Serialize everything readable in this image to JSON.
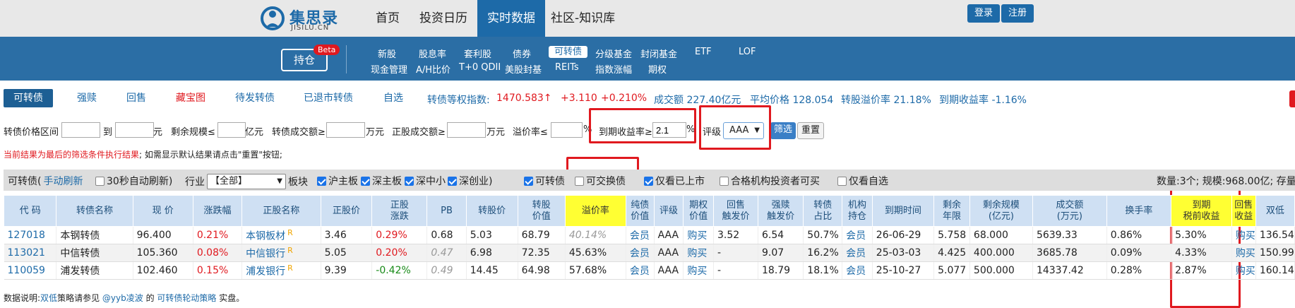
{
  "header": {
    "logo_cn": "集思录",
    "logo_en": "JISILU.CN",
    "nav": [
      "首页",
      "投资日历",
      "实时数据",
      "社区-知识库"
    ],
    "active_nav": "实时数据",
    "login": "登录",
    "register": "注册"
  },
  "subnav": {
    "hold_label": "持仓",
    "beta": "Beta",
    "row1": [
      "新股",
      "股息率",
      "套利股",
      "债券",
      "可转债",
      "分级基金",
      "封闭基金",
      "ETF",
      "LOF"
    ],
    "row2": [
      "现金管理",
      "A/H比价",
      "T+0 QDII",
      "美股封基",
      "REITs",
      "指数涨幅",
      "期权"
    ],
    "active": "可转债"
  },
  "tabs": [
    "可转债",
    "强赎",
    "回售",
    "藏宝图",
    "待发转债",
    "已退市转债",
    "自选"
  ],
  "stats": {
    "index_label": "转债等权指数:",
    "index_value": "1470.583↑",
    "change": "+3.110",
    "change_pct": "+0.210%",
    "volume": "成交额 227.40亿元",
    "avg_price": "平均价格 128.054",
    "premium": "转股溢价率 21.18%",
    "ytm": "到期收益率 -1.16%"
  },
  "filters": {
    "price_range": "转债价格区间",
    "to": "到",
    "yuan": "元",
    "remaining_scale": "剩余规模≤",
    "yiyuan": "亿元",
    "bond_volume": "转债成交额≥",
    "wanyuan1": "万元",
    "stock_volume": "正股成交额≥",
    "wanyuan2": "万元",
    "premium_rate": "溢价率≤",
    "pct": "%",
    "ytm_label": "到期收益率≥",
    "ytm_value": "2.1",
    "pct2": "%",
    "rating_label": "评级",
    "rating_value": "AAA",
    "filter_btn": "筛选",
    "reset_btn": "重置"
  },
  "note_red": "当前结果为最后的筛选条件执行结果",
  "note_rest": "; 如需显示默认结果请点击\"重置\"按钮;",
  "options": {
    "cb_label": "可转债(",
    "manual_refresh": "手动刷新",
    "auto_refresh": "30秒自动刷新)",
    "industry": "行业",
    "industry_value": "【全部】",
    "sector": "板块",
    "sh": "沪主板",
    "sz": "深主板",
    "smb": "深中小",
    "gem": "深创业)",
    "convertible": "可转债",
    "exchangeable": "可交换债",
    "listed_only": "仅看已上市",
    "qualified": "合格机构投资者可买",
    "watch_only": "仅看自选",
    "summary": "数量:3个; 规模:968.00亿; 存量"
  },
  "table": {
    "headers": [
      "代 码",
      "转债名称",
      "现 价",
      "涨跌幅",
      "正股名称",
      "正股价",
      "正股\n涨跌",
      "PB",
      "转股价",
      "转股\n价值",
      "溢价率",
      "纯债\n价值",
      "评级",
      "期权\n价值",
      "回售\n触发价",
      "强赎\n触发价",
      "转债\n占比",
      "机构\n持仓",
      "到期时间",
      "剩余\n年限",
      "剩余规模\n(亿元)",
      "成交额\n(万元)",
      "换手率",
      "到期\n税前收益",
      "回售\n收益",
      "双低"
    ],
    "rows": [
      [
        "127018",
        "本钢转债",
        "96.400",
        "0.21%",
        "本钢板材",
        "3.46",
        "0.29%",
        "0.68",
        "5.03",
        "68.79",
        "40.14%",
        "会员",
        "AAA",
        "购买",
        "3.52",
        "6.54",
        "50.7%",
        "会员",
        "26-06-29",
        "5.758",
        "68.000",
        "5639.33",
        "0.86%",
        "5.30%",
        "购买",
        "136.54"
      ],
      [
        "113021",
        "中信转债",
        "105.360",
        "0.08%",
        "中信银行",
        "5.05",
        "0.20%",
        "0.47",
        "6.98",
        "72.35",
        "45.63%",
        "会员",
        "AAA",
        "购买",
        "-",
        "9.07",
        "16.2%",
        "会员",
        "25-03-03",
        "4.425",
        "400.000",
        "3685.78",
        "0.09%",
        "4.33%",
        "购买",
        "150.99"
      ],
      [
        "110059",
        "浦发转债",
        "102.460",
        "0.15%",
        "浦发银行",
        "9.39",
        "-0.42%",
        "0.49",
        "14.45",
        "64.98",
        "57.68%",
        "会员",
        "AAA",
        "购买",
        "-",
        "18.79",
        "18.1%",
        "会员",
        "25-10-27",
        "5.077",
        "500.000",
        "14337.42",
        "0.28%",
        "2.87%",
        "购买",
        "160.14"
      ]
    ]
  },
  "footnote": {
    "prefix": "数据说明:",
    "link1": "双低",
    "mid": "策略请参见",
    "link2": "@yyb凌波",
    "mid2": "的",
    "link3": "可转债轮动策略",
    "suffix": "实盘。"
  },
  "colors": {
    "brand": "#1d6aa8",
    "up": "#e0191f",
    "down": "#178a17",
    "highlight": "#ffff33"
  }
}
